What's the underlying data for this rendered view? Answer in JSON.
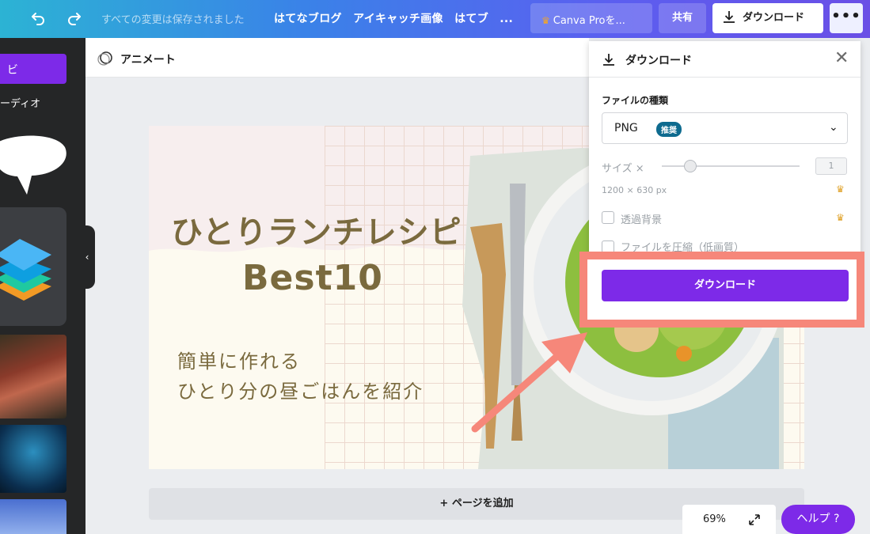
{
  "topbar": {
    "saved_text": "すべての変更は保存されました",
    "doc_title": "はてなブログ　アイキャッチ画像　はてブ　...",
    "pro_label": "Canva Proを...",
    "share_label": "共有",
    "download_label": "ダウンロード",
    "more_label": "•••"
  },
  "sidebar": {
    "active_item": "  ビ",
    "audio_label": "ーディオ"
  },
  "subbar": {
    "animate_label": "アニメート"
  },
  "canvas": {
    "title_line1": "ひとりランチレシピ",
    "title_line2": "Best10",
    "subtitle_line1": "簡単に作れる",
    "subtitle_line2": "ひとり分の昼ごはんを紹介"
  },
  "footer": {
    "add_page": "+ ページを追加",
    "zoom": "69%",
    "help": "ヘルプ ?"
  },
  "download_panel": {
    "title": "ダウンロード",
    "file_type_label": "ファイルの種類",
    "file_type_value": "PNG",
    "recommended_badge": "推奨",
    "size_label": "サイズ ×",
    "size_value": "1",
    "dimensions": "1200 × 630 px",
    "transparent_bg_label": "透過背景",
    "compress_label": "ファイルを圧縮（低画質）",
    "download_button": "ダウンロード"
  },
  "colors": {
    "brand_purple": "#7d2ae8",
    "highlight": "#f6877a",
    "canvas_text": "#7a6a3e",
    "crown": "#e0a32b"
  }
}
